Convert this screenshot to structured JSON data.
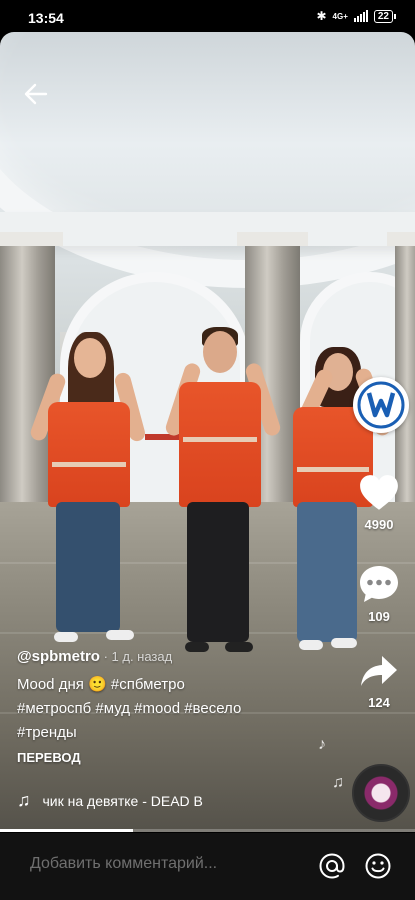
{
  "status_bar": {
    "time": "13:54",
    "network": "4G+",
    "battery": "22"
  },
  "video": {
    "progress_fraction": 0.32
  },
  "actions": {
    "likes": "4990",
    "comments": "109",
    "shares": "124"
  },
  "caption": {
    "author": "@spbmetro",
    "time": " · 1 д. назад",
    "desc_line1": "Mood дня 🙂 #спбметро",
    "desc_line2": "#метроспб #муд #mood #весело",
    "desc_line3": "#тренды",
    "translate_label": "ПЕРЕВОД"
  },
  "music": {
    "title": "чик на девятке - DEAD B"
  },
  "comment_bar": {
    "placeholder": "Добавить комментарий..."
  },
  "colors": {
    "vest": "#e8552a",
    "metro_logo": "#1a5fb4"
  }
}
